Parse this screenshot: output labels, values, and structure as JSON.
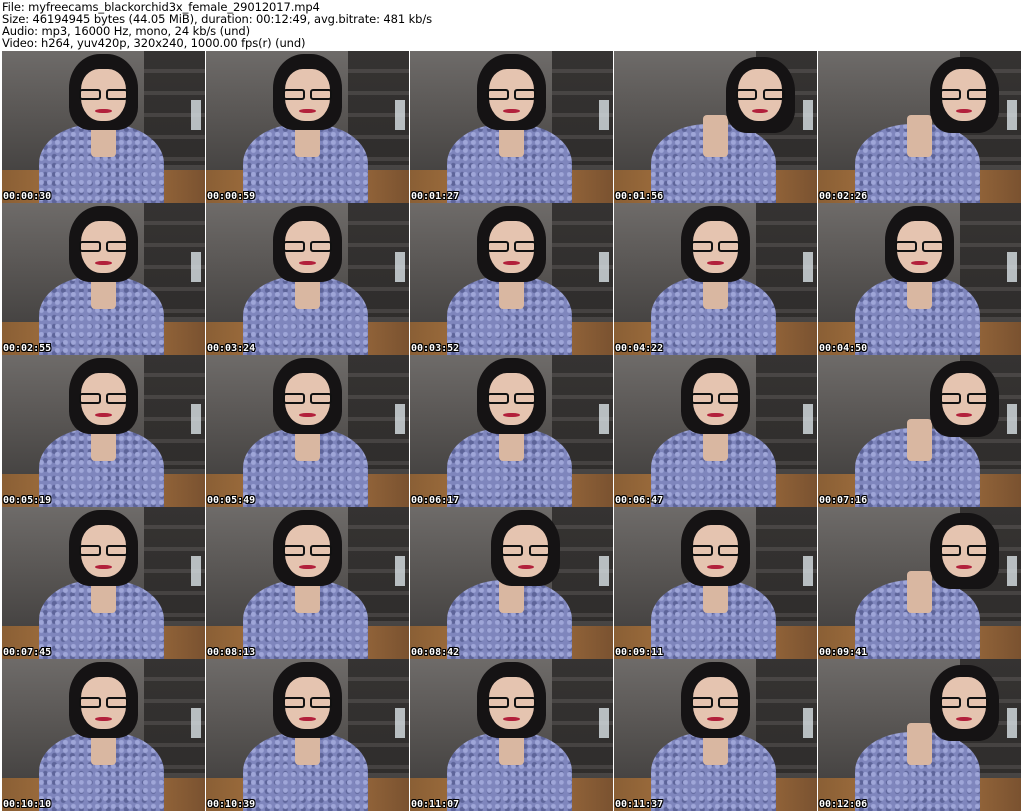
{
  "header": {
    "file_line": "File: myfreecams_blackorchid3x_female_29012017.mp4",
    "size_line": "Size: 46194945 bytes (44.05 MiB), duration: 00:12:49, avg.bitrate: 481 kb/s",
    "audio_line": "Audio: mp3, 16000 Hz, mono, 24 kb/s (und)",
    "video_line": "Video: h264, yuv420p, 320x240, 1000.00 fps(r) (und)"
  },
  "thumbnails": [
    {
      "timestamp": "00:00:30"
    },
    {
      "timestamp": "00:00:59"
    },
    {
      "timestamp": "00:01:27"
    },
    {
      "timestamp": "00:01:56"
    },
    {
      "timestamp": "00:02:26"
    },
    {
      "timestamp": "00:02:55"
    },
    {
      "timestamp": "00:03:24"
    },
    {
      "timestamp": "00:03:52"
    },
    {
      "timestamp": "00:04:22"
    },
    {
      "timestamp": "00:04:50"
    },
    {
      "timestamp": "00:05:19"
    },
    {
      "timestamp": "00:05:49"
    },
    {
      "timestamp": "00:06:17"
    },
    {
      "timestamp": "00:06:47"
    },
    {
      "timestamp": "00:07:16"
    },
    {
      "timestamp": "00:07:45"
    },
    {
      "timestamp": "00:08:13"
    },
    {
      "timestamp": "00:08:42"
    },
    {
      "timestamp": "00:09:11"
    },
    {
      "timestamp": "00:09:41"
    },
    {
      "timestamp": "00:10:10"
    },
    {
      "timestamp": "00:10:39"
    },
    {
      "timestamp": "00:11:07"
    },
    {
      "timestamp": "00:11:37"
    },
    {
      "timestamp": "00:12:06"
    }
  ]
}
